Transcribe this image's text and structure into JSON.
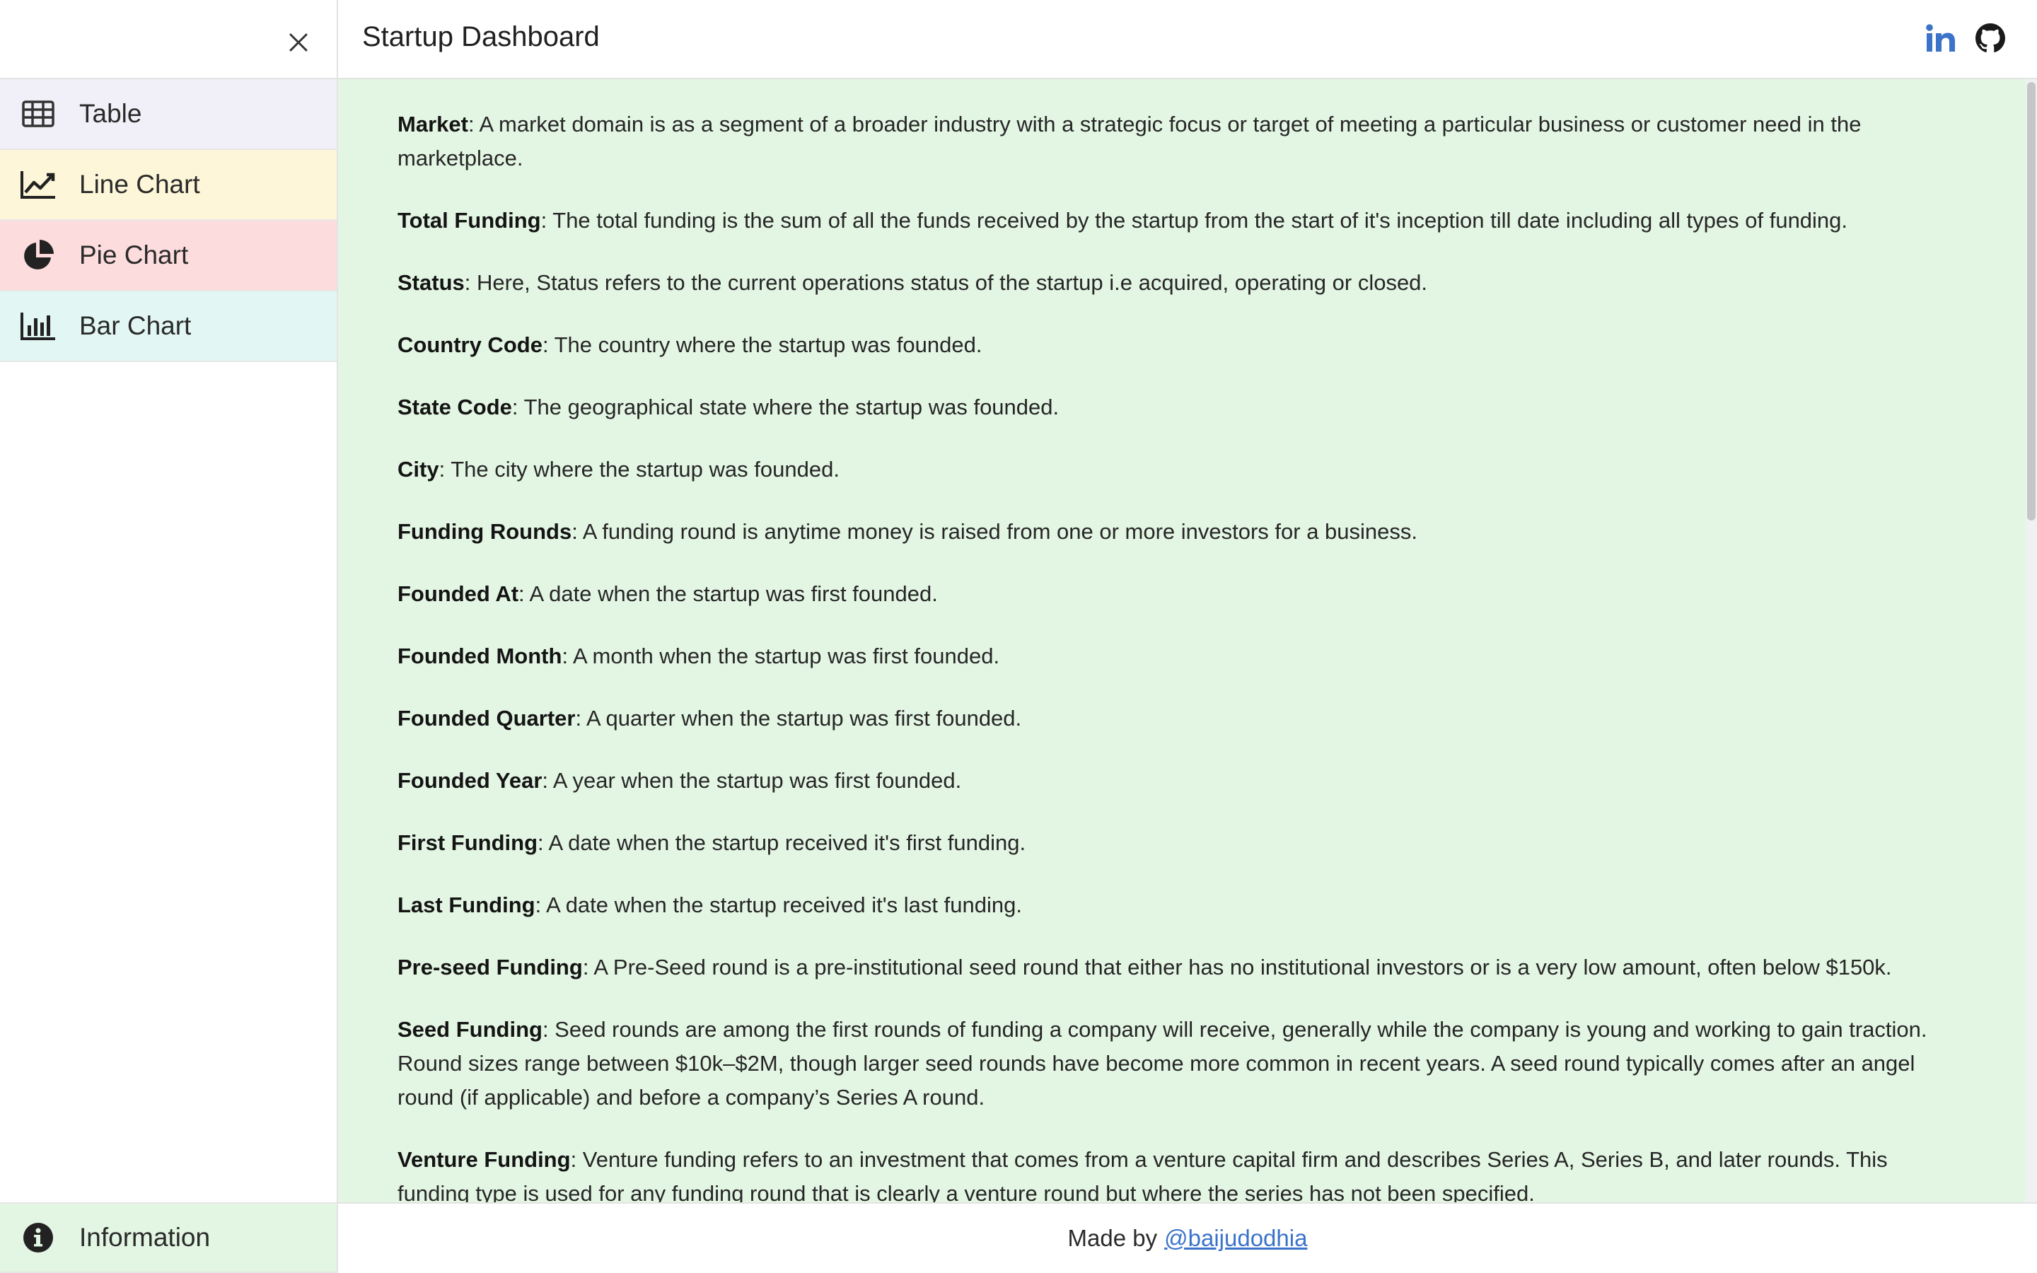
{
  "header": {
    "title": "Startup Dashboard",
    "linkedin_icon": "linkedin-icon",
    "github_icon": "github-icon"
  },
  "sidebar": {
    "close_icon": "close-icon",
    "items": [
      {
        "label": "Table",
        "icon": "table-icon",
        "bg": "#f1eff7"
      },
      {
        "label": "Line Chart",
        "icon": "line-chart-icon",
        "bg": "#fdf6d8"
      },
      {
        "label": "Pie Chart",
        "icon": "pie-chart-icon",
        "bg": "#fcdcdc"
      },
      {
        "label": "Bar Chart",
        "icon": "bar-chart-icon",
        "bg": "#e2f7f3"
      }
    ],
    "bottom_item": {
      "label": "Information",
      "icon": "info-icon",
      "bg": "#e3f5e3"
    }
  },
  "content": {
    "definitions": [
      {
        "term": "Market",
        "text": ": A market domain is as a segment of a broader industry with a strategic focus or target of meeting a particular business or customer need in the marketplace."
      },
      {
        "term": "Total Funding",
        "text": ": The total funding is the sum of all the funds received by the startup from the start of it's inception till date including all types of funding."
      },
      {
        "term": "Status",
        "text": ": Here, Status refers to the current operations status of the startup i.e acquired, operating or closed."
      },
      {
        "term": "Country Code",
        "text": ": The country where the startup was founded."
      },
      {
        "term": "State Code",
        "text": ": The geographical state where the startup was founded."
      },
      {
        "term": "City",
        "text": ": The city where the startup was founded."
      },
      {
        "term": "Funding Rounds",
        "text": ": A funding round is anytime money is raised from one or more investors for a business."
      },
      {
        "term": "Founded At",
        "text": ": A date when the startup was first founded."
      },
      {
        "term": "Founded Month",
        "text": ": A month when the startup was first founded."
      },
      {
        "term": "Founded Quarter",
        "text": ": A quarter when the startup was first founded."
      },
      {
        "term": "Founded Year",
        "text": ": A year when the startup was first founded."
      },
      {
        "term": "First Funding",
        "text": ": A date when the startup received it's first funding."
      },
      {
        "term": "Last Funding",
        "text": ": A date when the startup received it's last funding."
      },
      {
        "term": "Pre-seed Funding",
        "text": ": A Pre-Seed round is a pre-institutional seed round that either has no institutional investors or is a very low amount, often below $150k."
      },
      {
        "term": "Seed Funding",
        "text": ": Seed rounds are among the first rounds of funding a company will receive, generally while the company is young and working to gain traction. Round sizes range between $10k–$2M, though larger seed rounds have become more common in recent years. A seed round typically comes after an angel round (if applicable) and before a company’s Series A round."
      },
      {
        "term": "Venture Funding",
        "text": ": Venture funding refers to an investment that comes from a venture capital firm and describes Series A, Series B, and later rounds. This funding type is used for any funding round that is clearly a venture round but where the series has not been specified."
      }
    ]
  },
  "footer": {
    "prefix": "Made by",
    "link_text": "@baijudodhia"
  },
  "colors": {
    "content_bg": "#e3f5e3",
    "link": "#3b73c9",
    "linkedin": "#3b73c9"
  }
}
